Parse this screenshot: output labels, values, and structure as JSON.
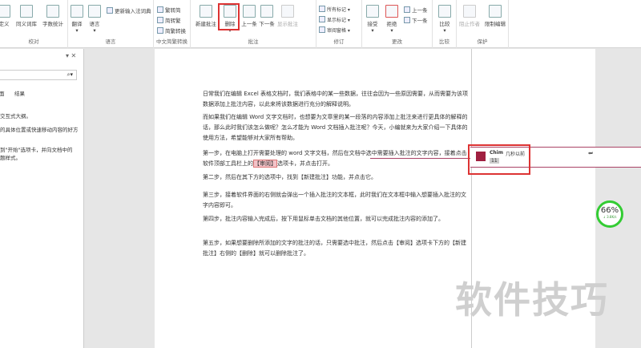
{
  "ribbon": {
    "proofing": {
      "label": "校对",
      "buttons": [
        "定义",
        "同义词库",
        "字数统计"
      ]
    },
    "language": {
      "label": "语言",
      "translate": "翻译",
      "language": "语言",
      "update_ime": "更新输入法词典"
    },
    "chinese": {
      "label": "中文简繁转换",
      "items": [
        "繁转简",
        "简转繁",
        "简繁转换"
      ]
    },
    "comments": {
      "label": "批注",
      "buttons": [
        "新建批注",
        "删除",
        "上一条",
        "下一条",
        "显示批注"
      ]
    },
    "tracking": {
      "label": "修订",
      "track": "修订",
      "markup": "所有标记",
      "show_markup": "显示标记",
      "review_pane": "审阅窗格"
    },
    "changes": {
      "label": "更改",
      "accept": "接受",
      "reject": "拒绝",
      "prev": "上一条",
      "next": "下一条"
    },
    "compare": {
      "label": "比较",
      "compare": "比较"
    },
    "protect": {
      "label": "保护",
      "block": "阻止作者",
      "restrict": "限制编辑"
    }
  },
  "nav": {
    "tabs": [
      "面",
      "结果"
    ],
    "lines": [
      "交互式大纲。",
      "的具体位置或快速移动内容的好方",
      "到\"开始\"选项卡，并向文档中的",
      "题样式。"
    ]
  },
  "doc": {
    "paragraphs": [
      "日常我们在编辑 Excel 表格文档时，我们表格中的某一些数据，往往会因为一些原因需要，从而需要为该项数据添加上批注内容，以此来将该数据进行充分的解释说明。",
      "而如果我们在编辑 Word 文字文档时，也想要为文章里的某一段落的内容添加上批注来进行更具体的解释的话，那么此时我们该怎么做呢？怎么才能为 Word 文档插入批注呢？今天，小编就来为大家介绍一下具体的使用方法，希望能够对大家所有帮助。",
      "第二步，然后在其下方的选项中，找到【新建批注】功能，并点击它。",
      "第三步，接着软件界面的右侧就会弹出一个插入批注的文本框，此时我们在文本框中输入想要插入批注的文字内容即可。",
      "第四步，批注内容输入完成后，按下用鼠标单击文档的其他位置，就可以完成批注内容的添加了。",
      "第五步，如果想要删除所添加的文字的批注的话，只需要选中批注，然后点击【审阅】选项卡下方的【新建批注】右侧的【删除】就可以删除批注了。"
    ],
    "step1_before": "第一步，在电脑上打开需要处理的 word 文字文档，然后在文档中选中需要插入批注的文字内容，接着点击软件顶部工具栏上的",
    "step1_mark": "【审阅】",
    "step1_after": "选项卡，并点击打开。"
  },
  "comment": {
    "author": "Chim",
    "time": "几秒以前",
    "text": "11"
  },
  "gauge": {
    "percent": "66%",
    "speed": "↓ 3.8K/s"
  },
  "watermark": "软件技巧"
}
